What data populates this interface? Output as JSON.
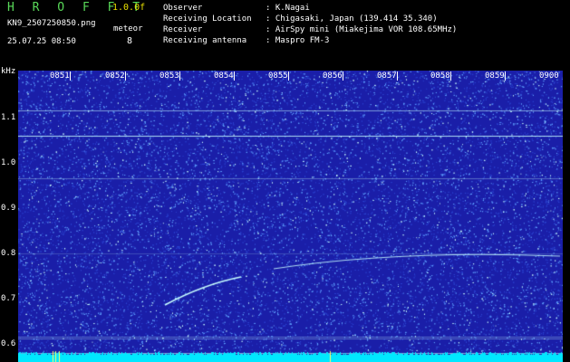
{
  "header": {
    "app_title": "H R O F F T",
    "version": "1.0.0f",
    "filename": "KN9_2507250850.png",
    "datetime": "25.07.25 08:50",
    "meteor_label": "meteor",
    "meteor_count": "8"
  },
  "info": [
    {
      "key": "Observer",
      "value": ": K.Nagai"
    },
    {
      "key": "Receiving Location",
      "value": ": Chigasaki, Japan (139.414 35.340)"
    },
    {
      "key": "Receiver",
      "value": ": AirSpy mini (Miakejima VOR 108.65MHz)"
    },
    {
      "key": "Receiving antenna",
      "value": ": Maspro FM-3"
    }
  ],
  "spectrogram": {
    "y_unit": "kHz",
    "y_ticks": [
      "1.1",
      "1.0",
      "0.9",
      "0.8",
      "0.7",
      "0.6"
    ],
    "x_ticks": [
      "0851",
      "0852",
      "0853",
      "0854",
      "0855",
      "0856",
      "0857",
      "0858",
      "0859",
      "0900"
    ],
    "x_range_minutes": [
      0,
      10
    ],
    "y_range_khz": [
      0.57,
      1.15
    ],
    "colors": {
      "background": "#1a1ea8",
      "noise": "#5fa0ff",
      "bright": "#c8ffff",
      "bottom_bar": "#00e8ff"
    }
  }
}
